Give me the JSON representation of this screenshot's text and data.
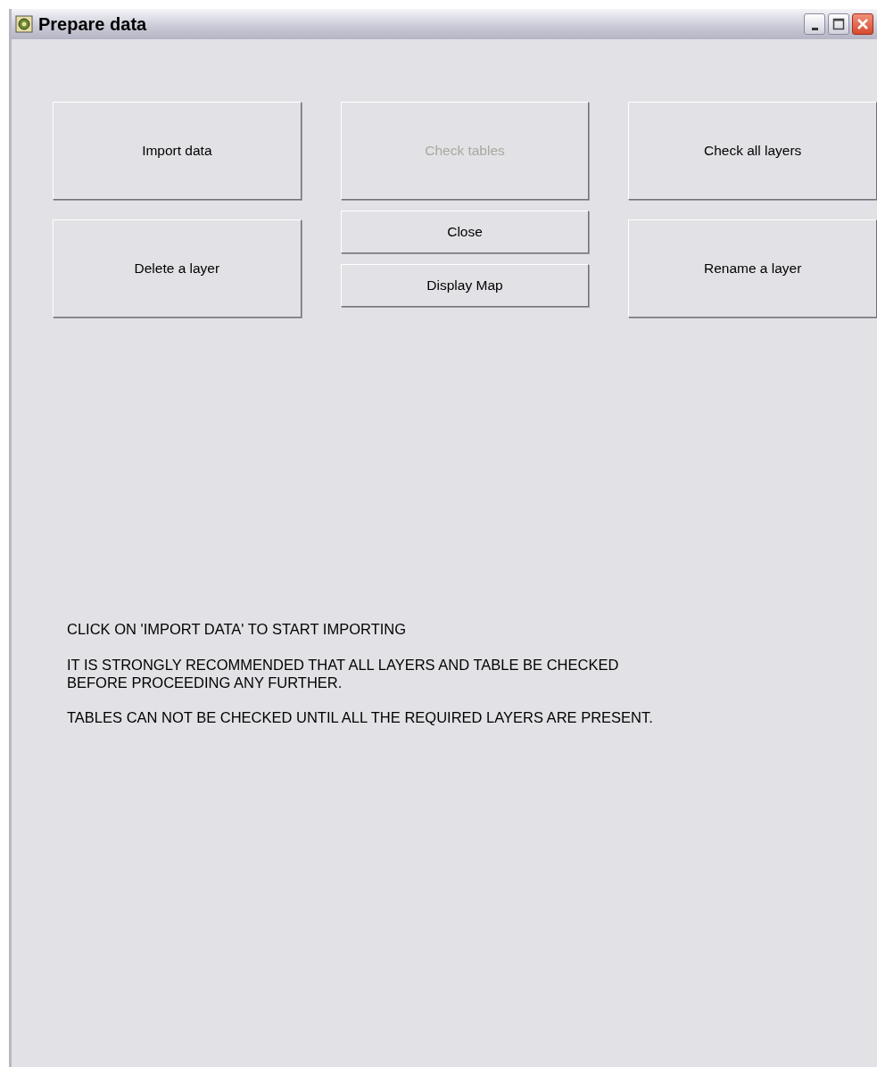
{
  "window": {
    "title": "Prepare data"
  },
  "button_columns": [
    [
      {
        "label": "Import data",
        "disabled": false,
        "kind": "tall"
      },
      {
        "label": "Delete a layer",
        "disabled": false,
        "kind": "tall"
      }
    ],
    [
      {
        "label": "Check tables",
        "disabled": true,
        "kind": "tall"
      },
      {
        "label": "Close",
        "disabled": false,
        "kind": "short"
      },
      {
        "label": "Display Map",
        "disabled": false,
        "kind": "short"
      }
    ],
    [
      {
        "label": "Check all layers",
        "disabled": false,
        "kind": "tall"
      },
      {
        "label": "Rename a layer",
        "disabled": false,
        "kind": "tall"
      }
    ]
  ],
  "messages": [
    {
      "lines": [
        "CLICK ON 'IMPORT DATA' TO START IMPORTING"
      ]
    },
    {
      "lines": [
        "IT IS STRONGLY RECOMMENDED THAT ALL LAYERS AND TABLE BE CHECKED",
        "BEFORE PROCEEDING ANY FURTHER."
      ]
    },
    {
      "lines": [
        "TABLES CAN NOT BE CHECKED UNTIL ALL THE REQUIRED LAYERS ARE PRESENT."
      ]
    }
  ]
}
